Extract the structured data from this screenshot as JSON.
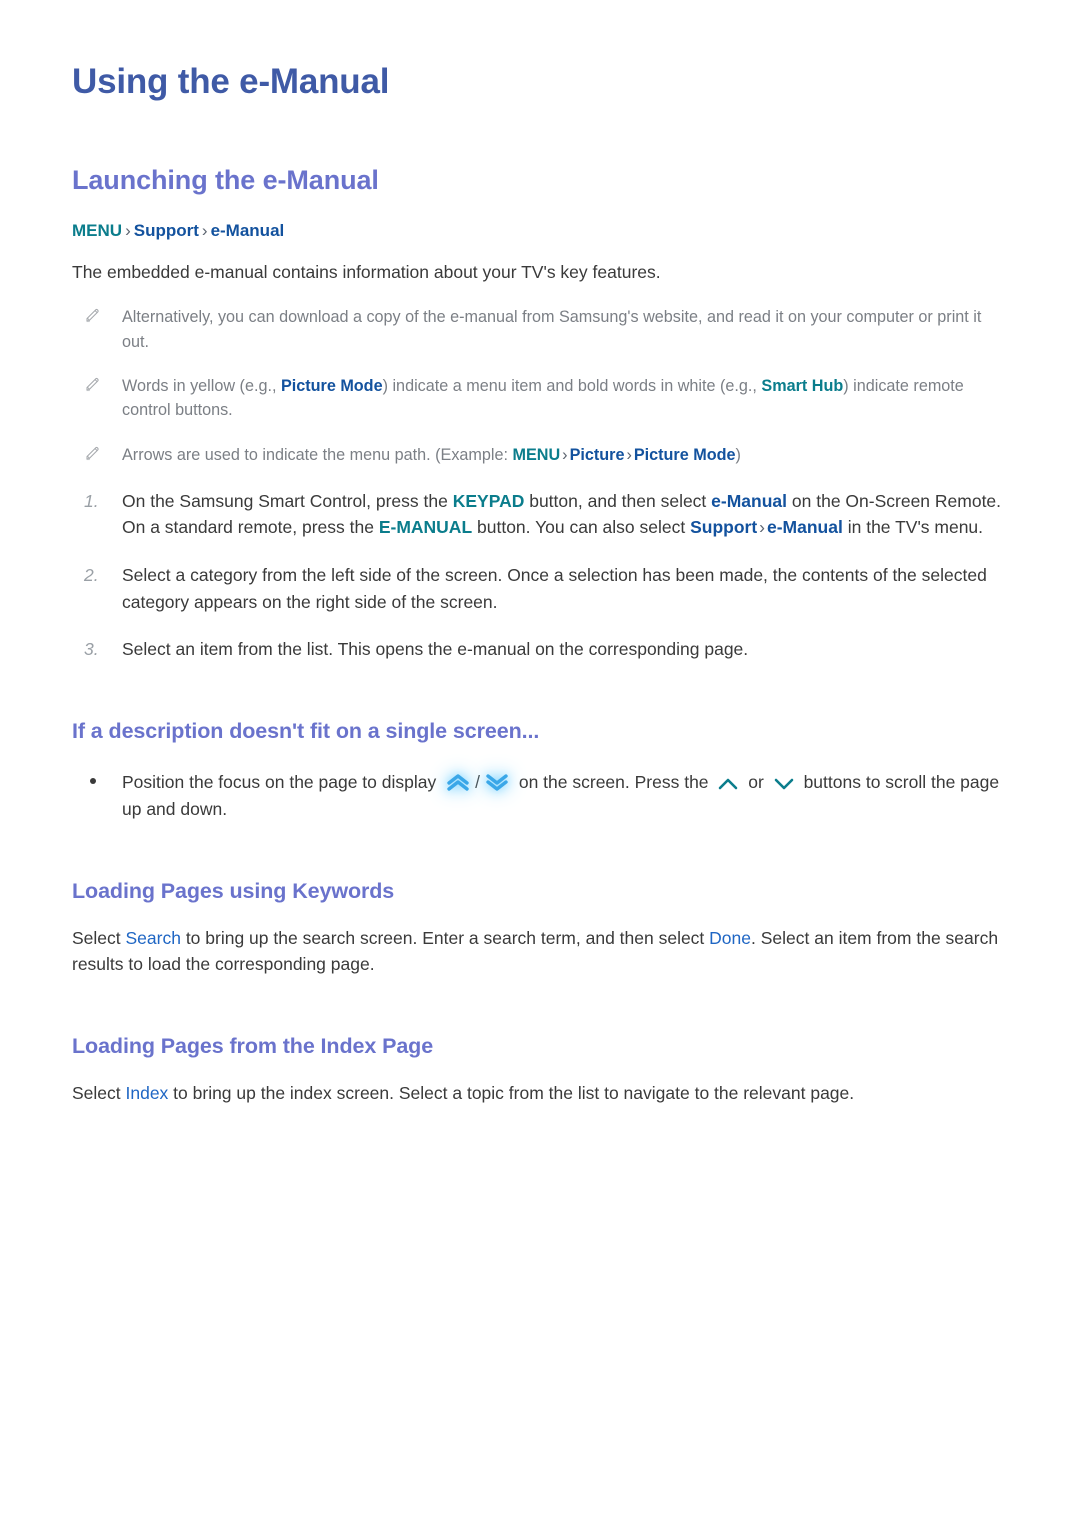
{
  "document": {
    "title": "Using the e-Manual"
  },
  "section_launching": {
    "heading": "Launching the e-Manual",
    "menu_path": {
      "item1": "MENU",
      "sep1": "›",
      "item2": "Support",
      "sep2": "›",
      "item3": "e-Manual"
    },
    "intro": "The embedded e-manual contains information about your TV's key features.",
    "notes": [
      {
        "icon": "pencil-icon",
        "text": "Alternatively, you can download a copy of the e-manual from Samsung's website, and read it on your computer or print it out."
      },
      {
        "icon": "pencil-icon",
        "t1": "Words in yellow (e.g., ",
        "kw1": "Picture Mode",
        "t2": ") indicate a menu item and bold words in white (e.g., ",
        "kw2": "Smart Hub",
        "t3": ") indicate remote control buttons."
      },
      {
        "icon": "pencil-icon",
        "t1": "Arrows are used to indicate the menu path. (Example: ",
        "kw1": "MENU",
        "sep1": "›",
        "kw2": "Picture",
        "sep2": "›",
        "kw3": "Picture Mode",
        "t2": ")"
      }
    ],
    "steps": [
      {
        "num": "1.",
        "t1": "On the Samsung Smart Control, press the ",
        "kw1": "KEYPAD",
        "t2": " button, and then select ",
        "kw2": "e-Manual",
        "t3": " on the On-Screen Remote. On a standard remote, press the ",
        "kw3": "E-MANUAL",
        "t4": " button. You can also select ",
        "kw4": "Support",
        "sep1": "›",
        "kw5": "e-Manual",
        "t5": " in the TV's menu."
      },
      {
        "num": "2.",
        "text": "Select a category from the left side of the screen. Once a selection has been made, the contents of the selected category appears on the right side of the screen."
      },
      {
        "num": "3.",
        "text": "Select an item from the list. This opens the e-manual on the corresponding page."
      }
    ]
  },
  "section_fit": {
    "heading": "If a description doesn't fit on a single screen...",
    "bullet": {
      "t1": "Position the focus on the page to display ",
      "icon_up": "double-chevron-up-icon",
      "slash": "/",
      "icon_down": "double-chevron-down-icon",
      "t2": " on the screen. Press the ",
      "icon_up2": "chevron-up-icon",
      "t3": " or ",
      "icon_down2": "chevron-down-icon",
      "t4": " buttons to scroll the page up and down."
    }
  },
  "section_keywords": {
    "heading": "Loading Pages using Keywords",
    "t1": "Select ",
    "lnk1": "Search",
    "t2": " to bring up the search screen. Enter a search term, and then select ",
    "lnk2": "Done",
    "t3": ". Select an item from the search results to load the corresponding page."
  },
  "section_index": {
    "heading": "Loading Pages from the Index Page",
    "t1": "Select ",
    "lnk1": "Index",
    "t2": " to bring up the index screen. Select a topic from the list to navigate to the relevant page."
  },
  "colors": {
    "title_blue": "#3f5aa6",
    "heading_purple": "#6a73cc",
    "keyword_blue": "#13529e",
    "keyword_teal": "#0b7d8c",
    "link_blue": "#1f66c4",
    "body_gray": "#3a3a3a",
    "note_gray": "#7b7f85",
    "chevron_glow": "#7fd4ff",
    "chevron_teal": "#0b7d8c"
  }
}
